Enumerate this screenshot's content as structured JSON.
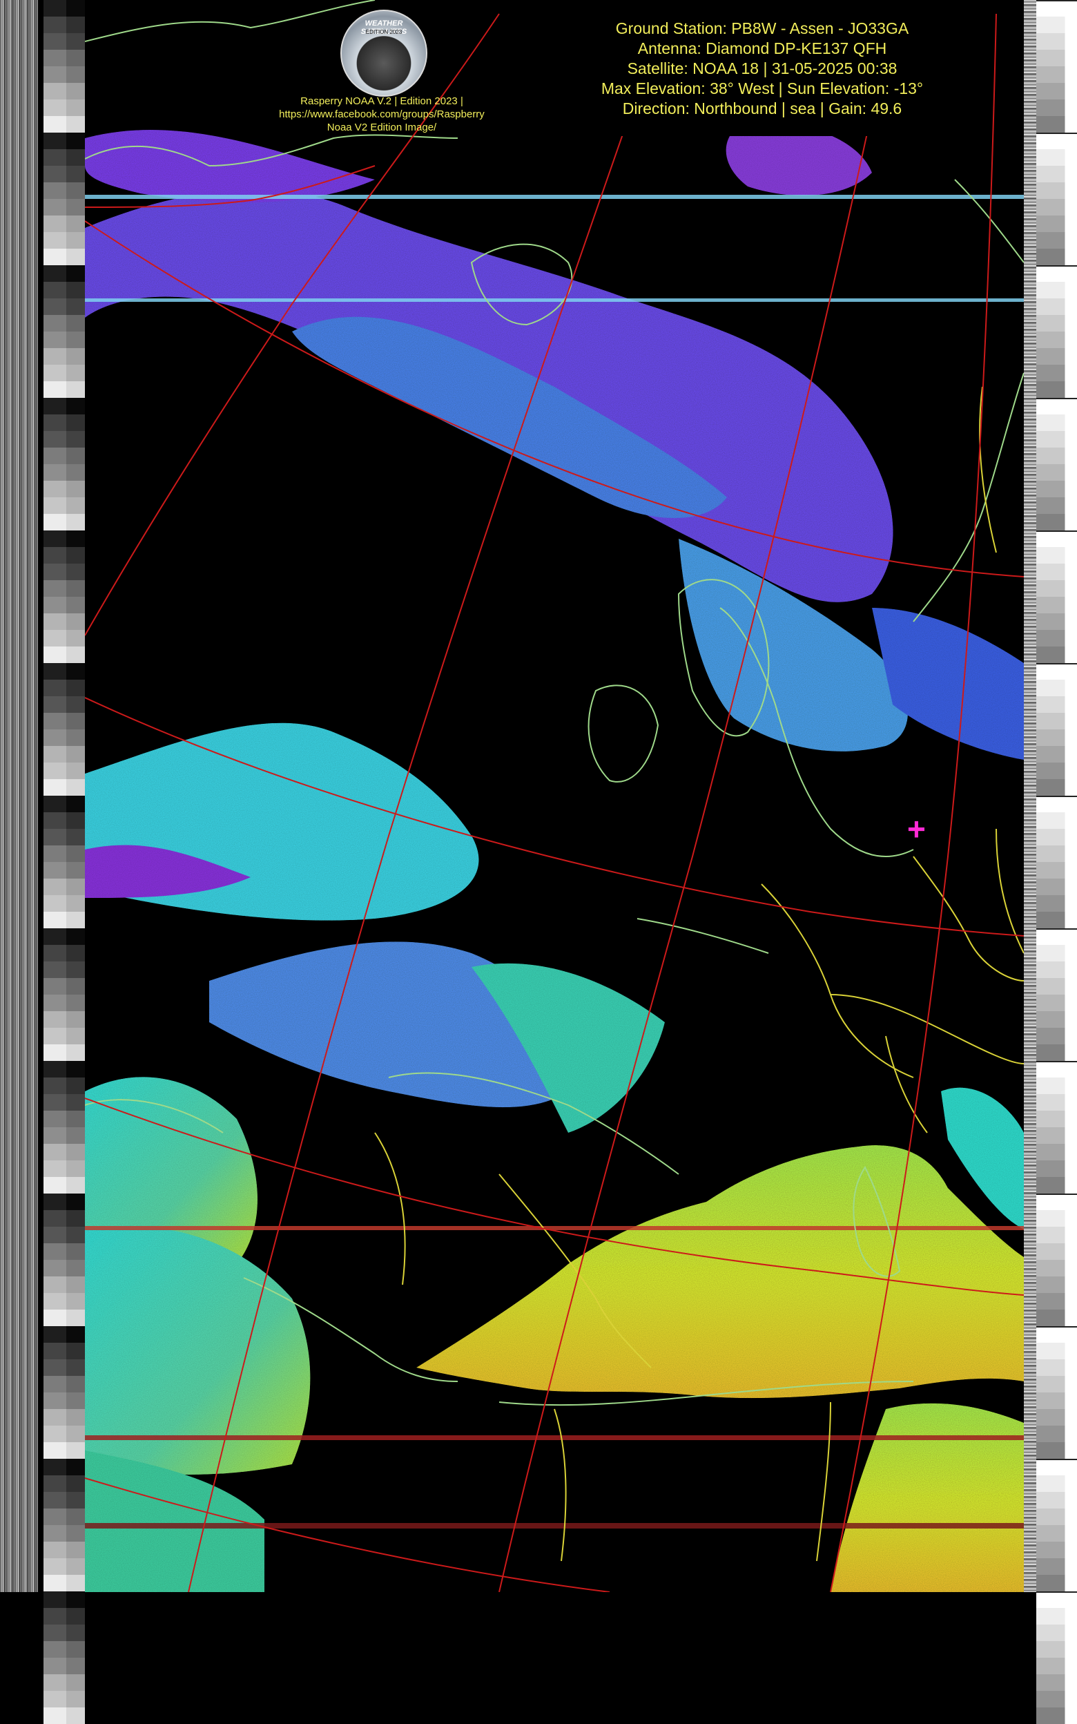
{
  "header": {
    "line1": "Ground Station: PB8W - Assen - JO33GA",
    "line2": "Antenna: Diamond DP-KE137 QFH",
    "line3": "Satellite: NOAA 18 | 31-05-2025 00:38",
    "line4": "Max Elevation: 38° West | Sun Elevation: -13°",
    "line5": "Direction: Northbound | sea | Gain: 49.6"
  },
  "logo": {
    "text": "WEATHER SATELLITES",
    "subtext": "EDITION 2023"
  },
  "credit": {
    "line1": "Rasperry NOAA V.2 | Edition 2023 |",
    "line2": "https://www.facebook.com/groups/Raspberry",
    "line3": "Noaa V2 Edition Image/"
  },
  "colors": {
    "header_text": "#f2ee5b",
    "graticule": "#cc1a1a",
    "coastline": "#9fd98a",
    "border": "#d9d237",
    "marker": "#ff2ad4"
  },
  "icons": {
    "marker": "station-crosshair-icon",
    "logo": "weather-satellites-logo"
  }
}
